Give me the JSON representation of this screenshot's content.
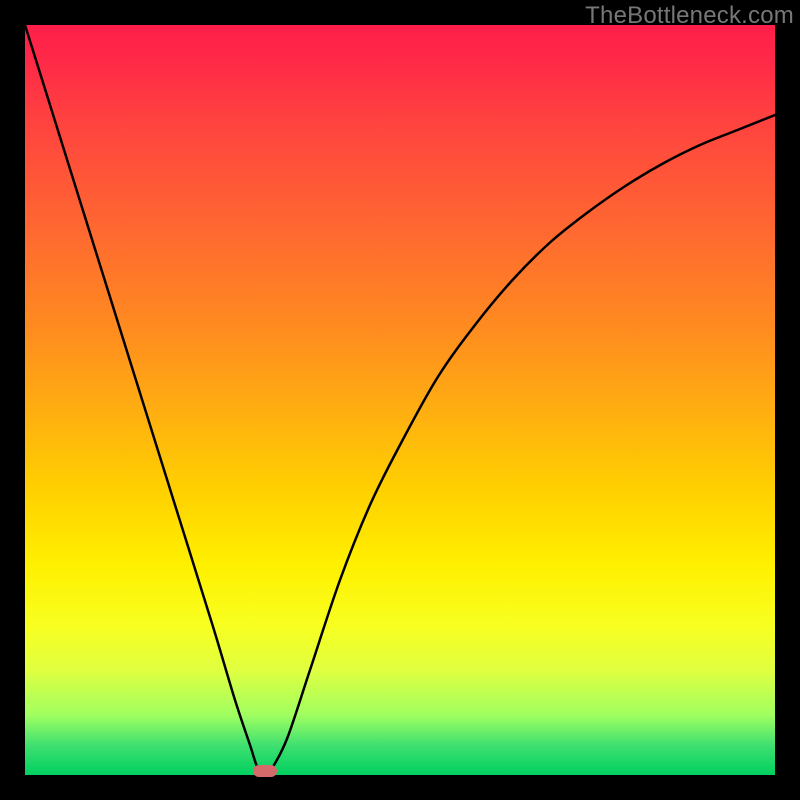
{
  "watermark": "TheBottleneck.com",
  "chart_data": {
    "type": "line",
    "title": "",
    "xlabel": "",
    "ylabel": "",
    "xlim": [
      0,
      100
    ],
    "ylim": [
      0,
      100
    ],
    "grid": false,
    "series": [
      {
        "name": "bottleneck-curve",
        "x": [
          0,
          5,
          10,
          15,
          20,
          25,
          28,
          30,
          31,
          32,
          33,
          35,
          38,
          42,
          46,
          50,
          55,
          60,
          65,
          70,
          75,
          80,
          85,
          90,
          95,
          100
        ],
        "y": [
          100,
          84,
          68,
          52,
          36,
          20,
          10,
          4,
          1,
          0,
          1,
          5,
          14,
          26,
          36,
          44,
          53,
          60,
          66,
          71,
          75,
          78.5,
          81.5,
          84,
          86,
          88
        ]
      }
    ],
    "minimum_point": {
      "x": 32,
      "y": 0
    },
    "gradient_stops": [
      {
        "pos": 0,
        "color": "#ff1e4a"
      },
      {
        "pos": 28,
        "color": "#ff6a30"
      },
      {
        "pos": 52,
        "color": "#ffb010"
      },
      {
        "pos": 72,
        "color": "#fff000"
      },
      {
        "pos": 92,
        "color": "#a0ff60"
      },
      {
        "pos": 100,
        "color": "#00d060"
      }
    ]
  }
}
